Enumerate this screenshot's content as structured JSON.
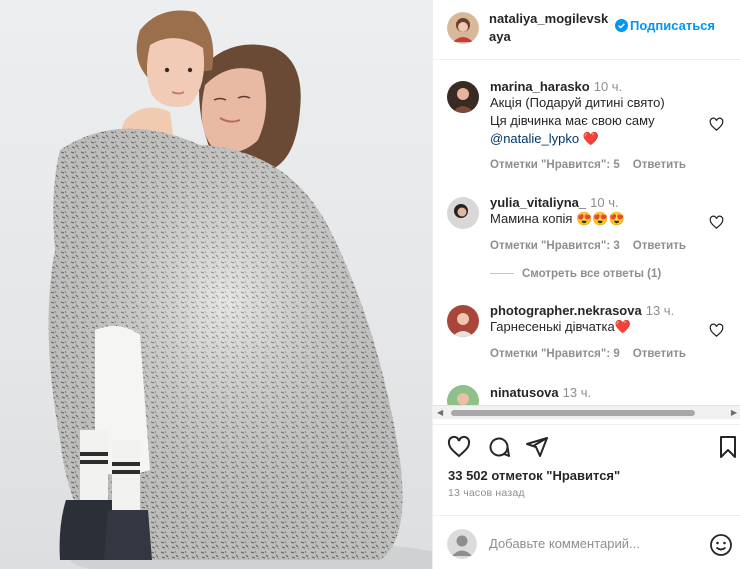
{
  "post": {
    "author": "nataliya_mogilevskaya",
    "follow_label": "Подписаться",
    "likes": "33 502 отметок \"Нравится\"",
    "time": "13 часов назад",
    "add_comment_placeholder": "Добавьте комментарий..."
  },
  "comments": [
    {
      "user": "marina_harasko",
      "time": "10 ч.",
      "text_lines": [
        "Акція (Подаруй дитині свято)",
        "Ця дівчинка має свою саму"
      ],
      "mention": "@natalie_lypko",
      "emoji": "❤️",
      "likes_label": "Отметки \"Нравится\": 5",
      "reply_label": "Ответить"
    },
    {
      "user": "yulia_vitaliyna_",
      "time": "10 ч.",
      "text": "Мамина копія",
      "emoji": "😍😍😍",
      "likes_label": "Отметки \"Нравится\": 3",
      "reply_label": "Ответить"
    },
    {
      "user": "photographer.nekrasova",
      "time": "13 ч.",
      "text": "Гарнесенькі дівчатка",
      "emoji": "❤️",
      "likes_label": "Отметки \"Нравится\": 9",
      "reply_label": "Ответить"
    },
    {
      "user": "ninatusova",
      "time": "13 ч."
    }
  ],
  "view_replies": "Смотреть все ответы (1)",
  "colors": {
    "accent": "#0095f6",
    "link": "#00376b",
    "muted": "#8e8e8e",
    "heart": "#ed4956"
  },
  "icons": [
    "verified-badge-icon",
    "heart-icon",
    "comment-icon",
    "share-icon",
    "bookmark-icon",
    "emoji-icon"
  ]
}
